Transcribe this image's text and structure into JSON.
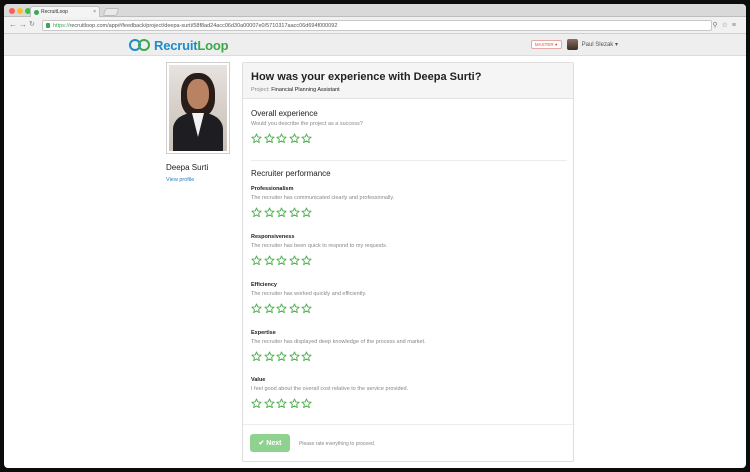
{
  "browser": {
    "tab_title": "RecruitLoop",
    "url_scheme": "https://",
    "url_rest": "recruitloop.com/app#/feedback/project/deepa-surti/58f8ad24acc06d30a00007e0/5710317aacc06d694f000092"
  },
  "app": {
    "logo_part1": "Recruit",
    "logo_part2": "Loop",
    "badge": "MASTER ●",
    "user_name": "Paul Slezak ▾"
  },
  "profile": {
    "name": "Deepa Surti",
    "link": "View profile"
  },
  "form": {
    "title": "How was your experience with Deepa Surti?",
    "project_label": "Project:",
    "project_name": "Financial Planning Assistant",
    "overall": {
      "title": "Overall experience",
      "description": "Would you describe the project as a success?",
      "rating": 0
    },
    "recruiter_title": "Recruiter performance",
    "criteria": [
      {
        "title": "Professionalism",
        "description": "The recruiter has communicated clearly and professionally.",
        "rating": 0
      },
      {
        "title": "Responsiveness",
        "description": "The recruiter has been quick to respond to my requests.",
        "rating": 0
      },
      {
        "title": "Efficiency",
        "description": "The recruiter has worked quickly and efficiently.",
        "rating": 0
      },
      {
        "title": "Expertise",
        "description": "The recruiter has displayed deep knowledge of the process and market.",
        "rating": 0
      },
      {
        "title": "Value",
        "description": "I feel good about the overall cost relative to the service provided.",
        "rating": 0
      }
    ],
    "max_stars": 5,
    "next_label": "✔ Next",
    "next_note": "Please rate everything to proceed."
  },
  "colors": {
    "star_outline": "#4cae4c",
    "next_button": "#8fd28f",
    "brand_blue": "#1f8bc9",
    "brand_green": "#3aaa4a"
  }
}
